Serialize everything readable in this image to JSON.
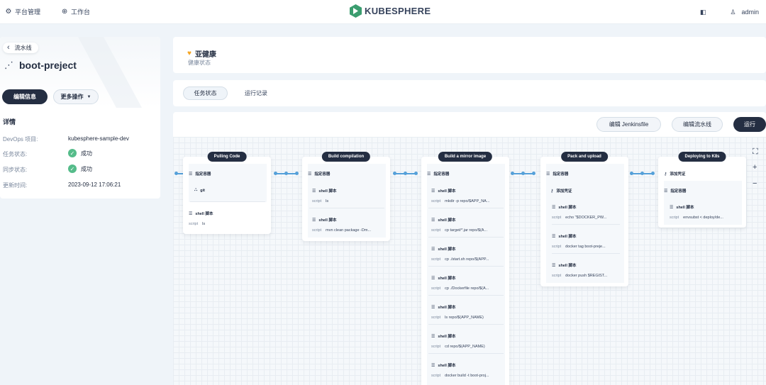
{
  "topbar": {
    "nav": [
      {
        "icon": "gear-icon",
        "glyph": "⚙",
        "label": "平台管理"
      },
      {
        "icon": "workbench-icon",
        "glyph": "⊕",
        "label": "工作台"
      }
    ],
    "logo_text": "KUBESPHERE",
    "user": "admin"
  },
  "left": {
    "back_label": "流水线",
    "pipeline_name": "boot-preject",
    "edit_info": "编辑信息",
    "more_actions": "更多操作",
    "detail_title": "详情",
    "details": [
      {
        "label": "DevOps 项目:",
        "value": "kubesphere-sample-dev",
        "status": false
      },
      {
        "label": "任务状态:",
        "value": "成功",
        "status": true
      },
      {
        "label": "同步状态:",
        "value": "成功",
        "status": true
      },
      {
        "label": "更新时间:",
        "value": "2023-09-12 17:06:21",
        "status": false
      }
    ]
  },
  "health": {
    "title": "亚健康",
    "subtitle": "健康状态"
  },
  "tabs": {
    "active": "任务状态",
    "other": "运行记录"
  },
  "toolbar": {
    "edit_jenkinsfile": "编辑 Jenkinsfile",
    "edit_pipeline": "编辑流水线",
    "run": "运行"
  },
  "stages": [
    {
      "title": "Pulling Code",
      "container": "指定容器",
      "steps": [
        {
          "type": "git",
          "name": "git"
        },
        {
          "type": "shell",
          "name": "shell 脚本",
          "script": "ls"
        }
      ]
    },
    {
      "title": "Build compilation",
      "container": "指定容器",
      "steps": [
        {
          "type": "shell",
          "name": "shell 脚本",
          "script": "ls"
        },
        {
          "type": "shell",
          "name": "shell 脚本",
          "script": "mvn clean package -Dm..."
        }
      ]
    },
    {
      "title": "Build a mirror image",
      "container": "指定容器",
      "steps": [
        {
          "type": "shell",
          "name": "shell 脚本",
          "script": "mkdir -p repo/$APP_NA..."
        },
        {
          "type": "shell",
          "name": "shell 脚本",
          "script": "cp target/*.jar repo/$(A..."
        },
        {
          "type": "shell",
          "name": "shell 脚本",
          "script": "cp ./start.sh repo/$(APP..."
        },
        {
          "type": "shell",
          "name": "shell 脚本",
          "script": "cp ./Dockerfile repo/$(A..."
        },
        {
          "type": "shell",
          "name": "shell 脚本",
          "script": "ls repo/$(APP_NAME)"
        },
        {
          "type": "shell",
          "name": "shell 脚本",
          "script": "cd repo/$(APP_NAME)"
        },
        {
          "type": "shell",
          "name": "shell 脚本",
          "script": "docker build -t boot-proj..."
        }
      ]
    },
    {
      "title": "Pack and upload",
      "container": "指定容器",
      "steps": [
        {
          "type": "cred",
          "name": "添加凭证"
        },
        {
          "type": "shell",
          "name": "shell 脚本",
          "script": "echo \"$DOCKER_PW..."
        },
        {
          "type": "shell",
          "name": "shell 脚本",
          "script": "docker tag boot-preje..."
        },
        {
          "type": "shell",
          "name": "shell 脚本",
          "script": "docker push $REGIST..."
        }
      ]
    },
    {
      "title": "Deploying to K8s",
      "credential": "添加凭证",
      "container": "指定容器",
      "steps": [
        {
          "type": "shell",
          "name": "shell 脚本",
          "script": "envsubst < deploy/de..."
        }
      ]
    }
  ],
  "script_label": "script"
}
